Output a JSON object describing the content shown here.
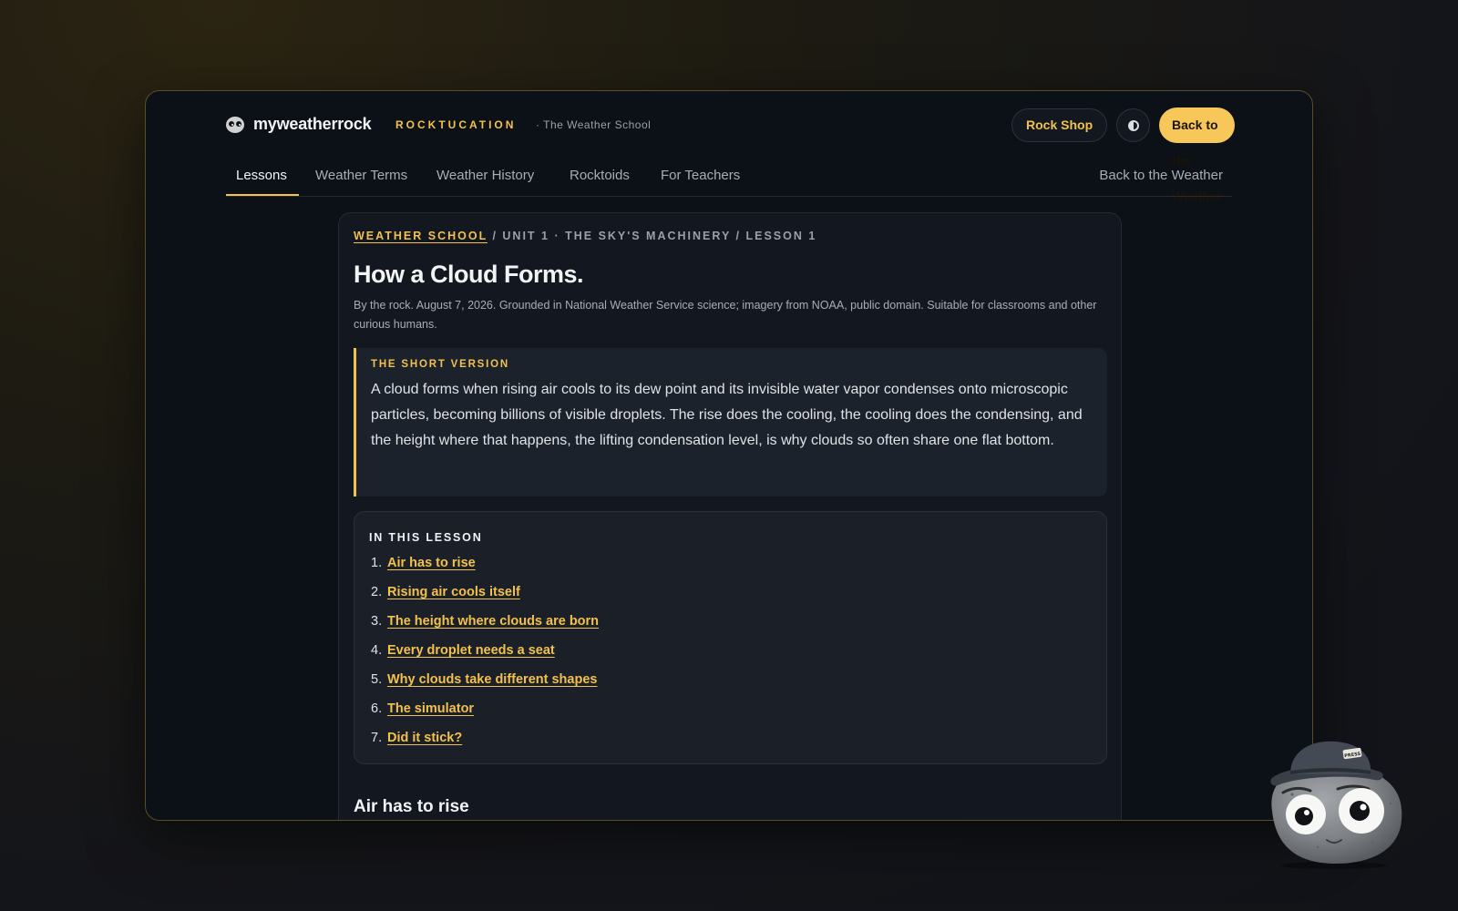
{
  "brand": {
    "name": "myweatherrock",
    "section": "ROCKTUCATION",
    "subtitle": "· The Weather School"
  },
  "header": {
    "shop_label": "Rock Shop",
    "back_label": "Back to the Weather"
  },
  "nav": {
    "tabs": [
      {
        "label": "Lessons"
      },
      {
        "label": "Weather Terms"
      },
      {
        "label": "Weather History"
      },
      {
        "label": "Rocktoids"
      },
      {
        "label": "For Teachers"
      }
    ],
    "right_label": "Back to the Weather"
  },
  "article": {
    "breadcrumb_home": "WEATHER SCHOOL",
    "breadcrumb_rest": " / UNIT 1 · THE SKY'S MACHINERY / LESSON 1",
    "title": "How a Cloud Forms.",
    "byline": "By the rock. August 7, 2026. Grounded in National Weather Service science; imagery from NOAA, public domain. Suitable for classrooms and other curious humans.",
    "short_label": "THE SHORT VERSION",
    "short_text": "A cloud forms when rising air cools to its dew point and its invisible water vapor condenses onto microscopic particles, becoming billions of visible droplets. The rise does the cooling, the cooling does the condensing, and the height where that happens, the lifting condensation level, is why clouds so often share one flat bottom.",
    "toc_label": "IN THIS LESSON",
    "toc": [
      {
        "num": "1.",
        "label": "Air has to rise"
      },
      {
        "num": "2.",
        "label": "Rising air cools itself"
      },
      {
        "num": "3.",
        "label": "The height where clouds are born"
      },
      {
        "num": "4.",
        "label": "Every droplet needs a seat"
      },
      {
        "num": "5.",
        "label": "Why clouds take different shapes"
      },
      {
        "num": "6.",
        "label": "The simulator"
      },
      {
        "num": "7.",
        "label": "Did it stick?"
      }
    ],
    "section_heading": "Air has to rise"
  },
  "mascot": {
    "hat_badge": "PRESS"
  },
  "colors": {
    "accent": "#f2c14e",
    "background": "#0c1017",
    "card": "#131820"
  }
}
